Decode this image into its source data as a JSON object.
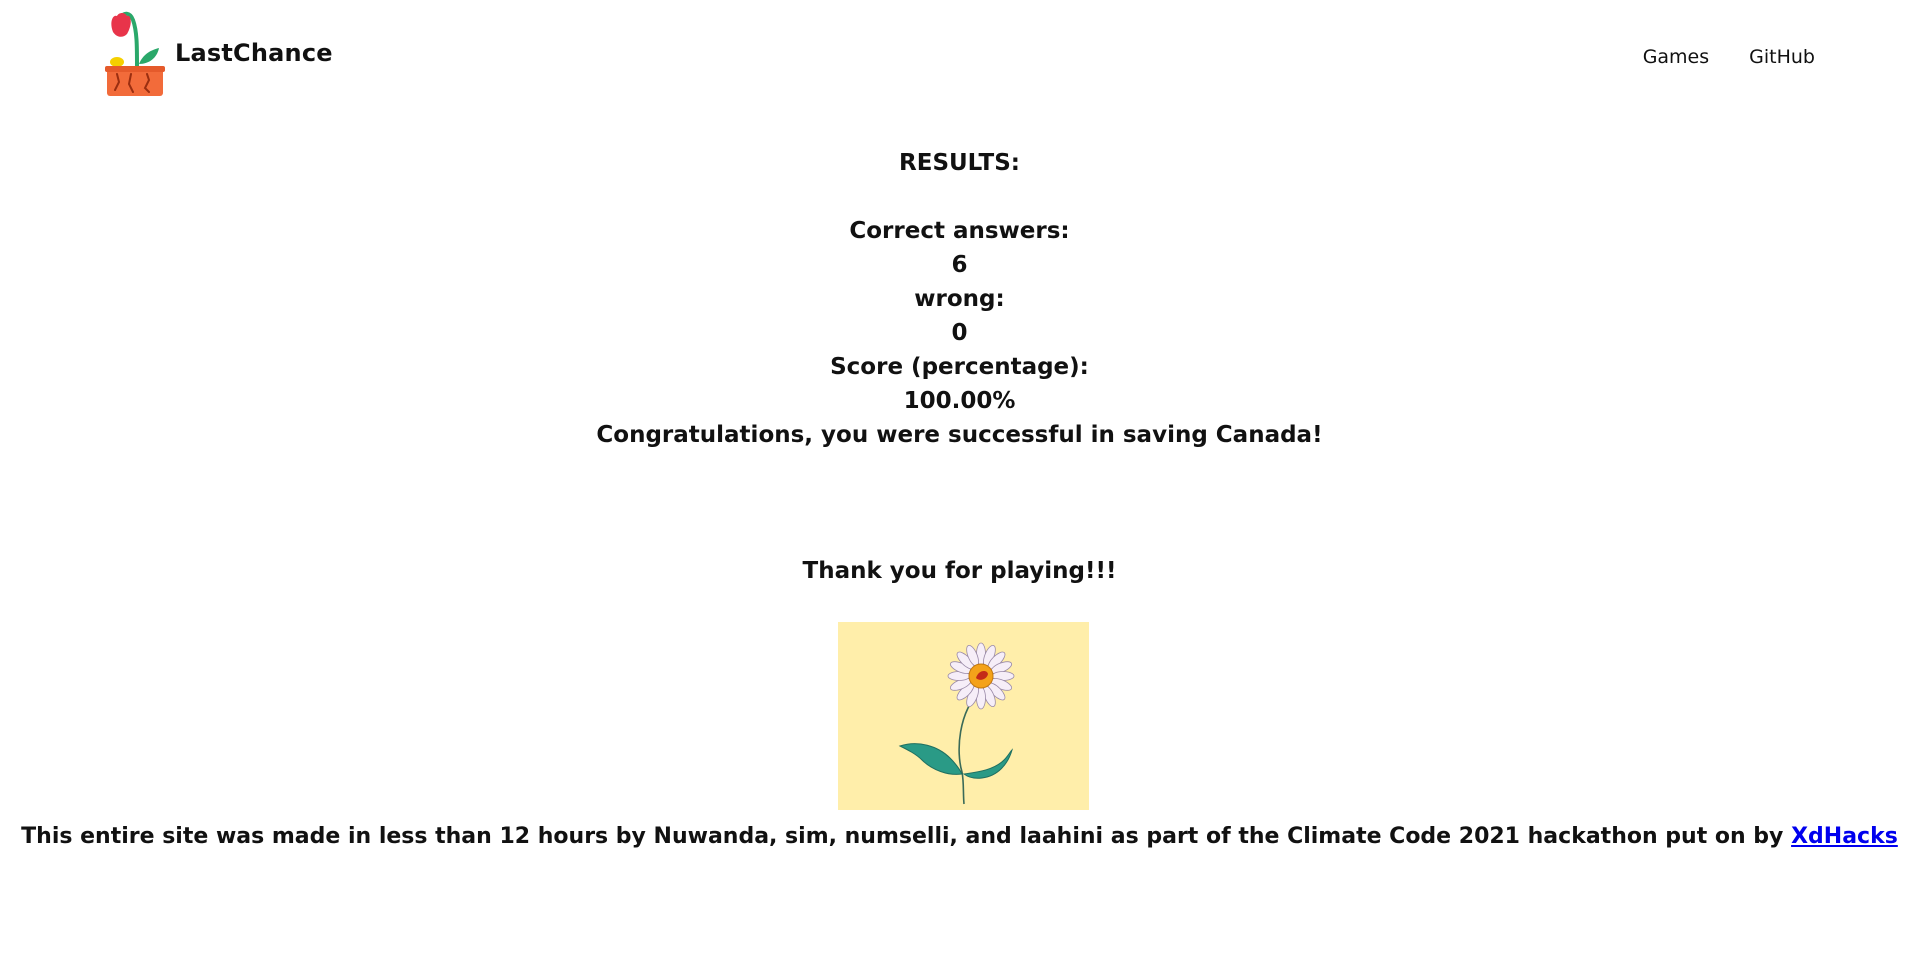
{
  "header": {
    "brand_name": "LastChance",
    "nav": [
      {
        "label": "Games"
      },
      {
        "label": "GitHub"
      }
    ]
  },
  "results": {
    "heading": "RESULTS:",
    "correct_label": "Correct answers:",
    "correct_value": "6",
    "wrong_label": "wrong:",
    "wrong_value": "0",
    "score_label": "Score (percentage):",
    "score_value": "100.00%",
    "message": "Congratulations, you were successful in saving Canada!"
  },
  "thanks": "Thank you for playing!!!",
  "illustration": {
    "background_color": "#ffeeaa",
    "icon": "daisy-flower-illustration"
  },
  "credits": {
    "text": "This entire site was made in less than 12 hours by Nuwanda, sim, numselli, and laahini as part of the Climate Code 2021 hackathon put on by",
    "link_label": "XdHacks"
  },
  "colors": {
    "link": "#0000ee",
    "text": "#111111",
    "pot": "#f26b3a",
    "leaf": "#2aa86a",
    "tulip": "#e8344a"
  }
}
